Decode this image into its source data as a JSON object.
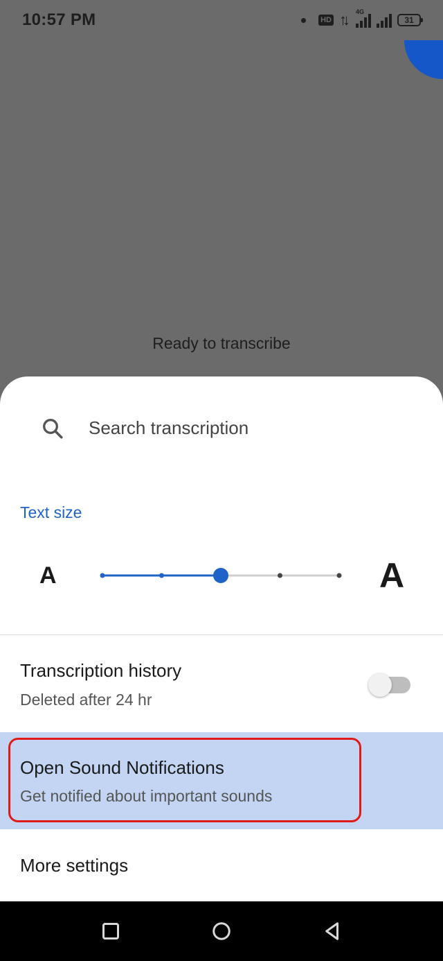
{
  "status_bar": {
    "time": "10:57 PM",
    "network_badge": "HD",
    "signal_label": "4G",
    "battery": "31"
  },
  "background": {
    "status_message": "Ready to transcribe"
  },
  "sheet": {
    "search": {
      "placeholder": "Search transcription",
      "icon": "search-icon"
    },
    "text_size": {
      "label": "Text size",
      "small_glyph": "A",
      "large_glyph": "A",
      "steps": 5,
      "selected_step": 2
    },
    "transcription_history": {
      "title": "Transcription history",
      "subtitle": "Deleted after 24 hr",
      "toggle_on": false
    },
    "sound_notifications": {
      "title": "Open Sound Notifications",
      "subtitle": "Get notified about important sounds"
    },
    "more_settings": {
      "title": "More settings"
    }
  },
  "colors": {
    "accent": "#1f63c8",
    "highlight_row": "#c3d5f2",
    "highlight_border": "#e01919",
    "scrim": "#6b6b6b"
  },
  "nav_bar": {
    "buttons": [
      "recents-icon",
      "home-icon",
      "back-icon"
    ]
  }
}
